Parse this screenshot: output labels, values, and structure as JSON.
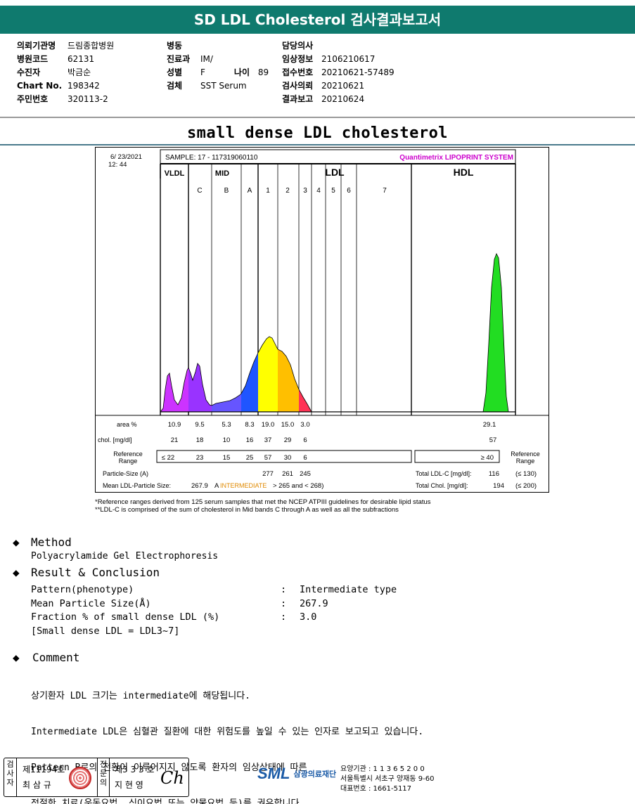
{
  "header": {
    "title": "SD LDL Cholesterol 검사결과보고서"
  },
  "patient_info": {
    "col1": [
      {
        "key": "의뢰기관명",
        "value": "드림종합병원"
      },
      {
        "key": "병원코드",
        "value": "62131"
      },
      {
        "key": "수진자",
        "value": "박금순"
      },
      {
        "key": "Chart No.",
        "value": "198342"
      },
      {
        "key": "주민번호",
        "value": "320113-2"
      }
    ],
    "col2": [
      {
        "key": "병동",
        "value": ""
      },
      {
        "key": "진료과",
        "value": "IM/"
      },
      {
        "key": "성별",
        "value": "F"
      },
      {
        "key": "검체",
        "value": "SST Serum"
      }
    ],
    "age": {
      "key": "나이",
      "value": "89"
    },
    "col3": [
      {
        "key": "담당의사",
        "value": ""
      },
      {
        "key": "임상정보",
        "value": "2106210617"
      },
      {
        "key": "접수번호",
        "value": "20210621-57489"
      },
      {
        "key": "검사의뢰",
        "value": "20210621"
      },
      {
        "key": "결과보고",
        "value": "20210624"
      }
    ]
  },
  "section_title": "small dense LDL cholesterol",
  "chart_data": {
    "type": "area",
    "date": "6/ 23/2021",
    "time": "12: 44",
    "sample": "SAMPLE:   17 - 117319060110",
    "system": "Quantimetrix LIPOPRINT SYSTEM",
    "groups": [
      "VLDL",
      "MID",
      "LDL",
      "HDL"
    ],
    "bands": [
      "C",
      "B",
      "A",
      "1",
      "2",
      "3",
      "4",
      "5",
      "6",
      "7"
    ],
    "colors": {
      "VLDL": "#cc33ff",
      "C": "#9933ff",
      "B": "#6655ff",
      "A": "#1f55ff",
      "1": "#ffff00",
      "2": "#ffbf00",
      "3": "#ff3355",
      "HDL": "#22dd22"
    },
    "rows": {
      "area_label": "area %",
      "area": [
        "10.9",
        "9.5",
        "5.3",
        "8.3",
        "19.0",
        "15.0",
        "3.0"
      ],
      "hdl_area": "29.1",
      "chol_label": "chol. [mg/dl]",
      "chol": [
        "21",
        "18",
        "10",
        "16",
        "37",
        "29",
        "6"
      ],
      "hdl_chol": "57",
      "ref_label_1": "Reference",
      "ref_label_2": "Range",
      "ref": [
        "≤ 22",
        "23",
        "15",
        "25",
        "57",
        "30",
        "6"
      ],
      "hdl_ref": "≥ 40",
      "particle_label": "Particle-Size (A)",
      "particle": [
        "277",
        "261",
        "245"
      ],
      "mean_label": "Mean LDL-Particle Size:",
      "mean_value": "267.9",
      "mean_class_a": "A",
      "mean_class_word": "INTERMEDIATE",
      "mean_range": "> 265 and < 268)",
      "total_ldl_label": "Total LDL-C [mg/dl]:",
      "total_ldl": "116",
      "total_ldl_ref": "(≤ 130)",
      "total_chol_label": "Total Chol. [mg/dl]:",
      "total_chol": "194",
      "total_chol_ref": "(≤ 200)"
    }
  },
  "footnote": [
    "*Reference ranges derived from 125 serum samples that met the NCEP ATPIII guidelines for desirable lipid status",
    "**LDL-C is comprised of the sum of cholesterol in Mid bands C through A as well as all the subfractions"
  ],
  "method": {
    "heading": "Method",
    "text": "Polyacrylamide Gel Electrophoresis"
  },
  "result": {
    "heading": "Result & Conclusion",
    "rows": [
      {
        "label": "Pattern(phenotype)",
        "value": "Intermediate type"
      },
      {
        "label": "Mean Particle Size(Å)",
        "value": "267.9"
      },
      {
        "label": "Fraction % of small dense LDL (%)",
        "value": "3.0"
      }
    ],
    "note": "[Small dense LDL = LDL3~7]"
  },
  "comment": {
    "heading": "Comment",
    "lines": [
      "상기환자 LDL 크기는 intermediate에 해당됩니다.",
      "Intermediate LDL은 심혈관 질환에 대한 위험도를 높일 수 있는 인자로 보고되고 있습니다.",
      "Pattern B로의 전환이 이루어지지 않도록 환자의 임상상태에 따른",
      "적절한 치료(운동요법, 식이요법 또는 약물요법 등)를 권유합니다."
    ]
  },
  "footer": {
    "tester_label": "검사자",
    "tester_no": "제11194호",
    "tester_name": "최 삼 규",
    "confirm_label": "전문의",
    "confirm_no": "제3 3 3 호",
    "confirm_name": "지 현 영",
    "signature": "Ch",
    "logo": "SML",
    "org": "삼광의료재단",
    "lines": [
      "요양기관 : 1 1 3 6 5 2 0 0",
      "서울특별시 서초구 양재동 9-60",
      "대표번호 : 1661-5117"
    ]
  }
}
